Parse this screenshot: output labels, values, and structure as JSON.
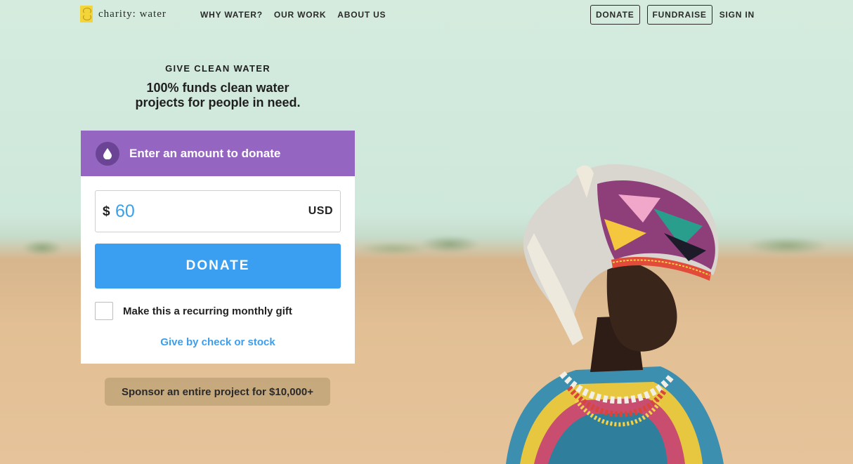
{
  "nav": {
    "logo_text": "charity: water",
    "links": [
      "WHY WATER?",
      "OUR WORK",
      "ABOUT US"
    ],
    "donate_label": "DONATE",
    "fundraise_label": "FUNDRAISE",
    "signin_label": "SIGN IN"
  },
  "hero": {
    "eyebrow": "GIVE CLEAN WATER",
    "headline_line1": "100% funds clean water",
    "headline_line2": "projects for people in need."
  },
  "donate_card": {
    "title": "Enter an amount to donate",
    "currency_symbol": "$",
    "amount_value": "60",
    "currency_code": "USD",
    "donate_button": "DONATE",
    "recurring_label": "Make this a recurring monthly gift",
    "recurring_checked": false,
    "check_stock_link": "Give by check or stock"
  },
  "sponsor": {
    "label": "Sponsor an entire project for $10,000+"
  },
  "colors": {
    "accent_purple": "#9566c1",
    "donate_blue": "#3a9ff0",
    "logo_yellow": "#f3d53a"
  },
  "icons": {
    "drop": "water-drop-icon",
    "logo": "jerrycan-logo-icon"
  }
}
